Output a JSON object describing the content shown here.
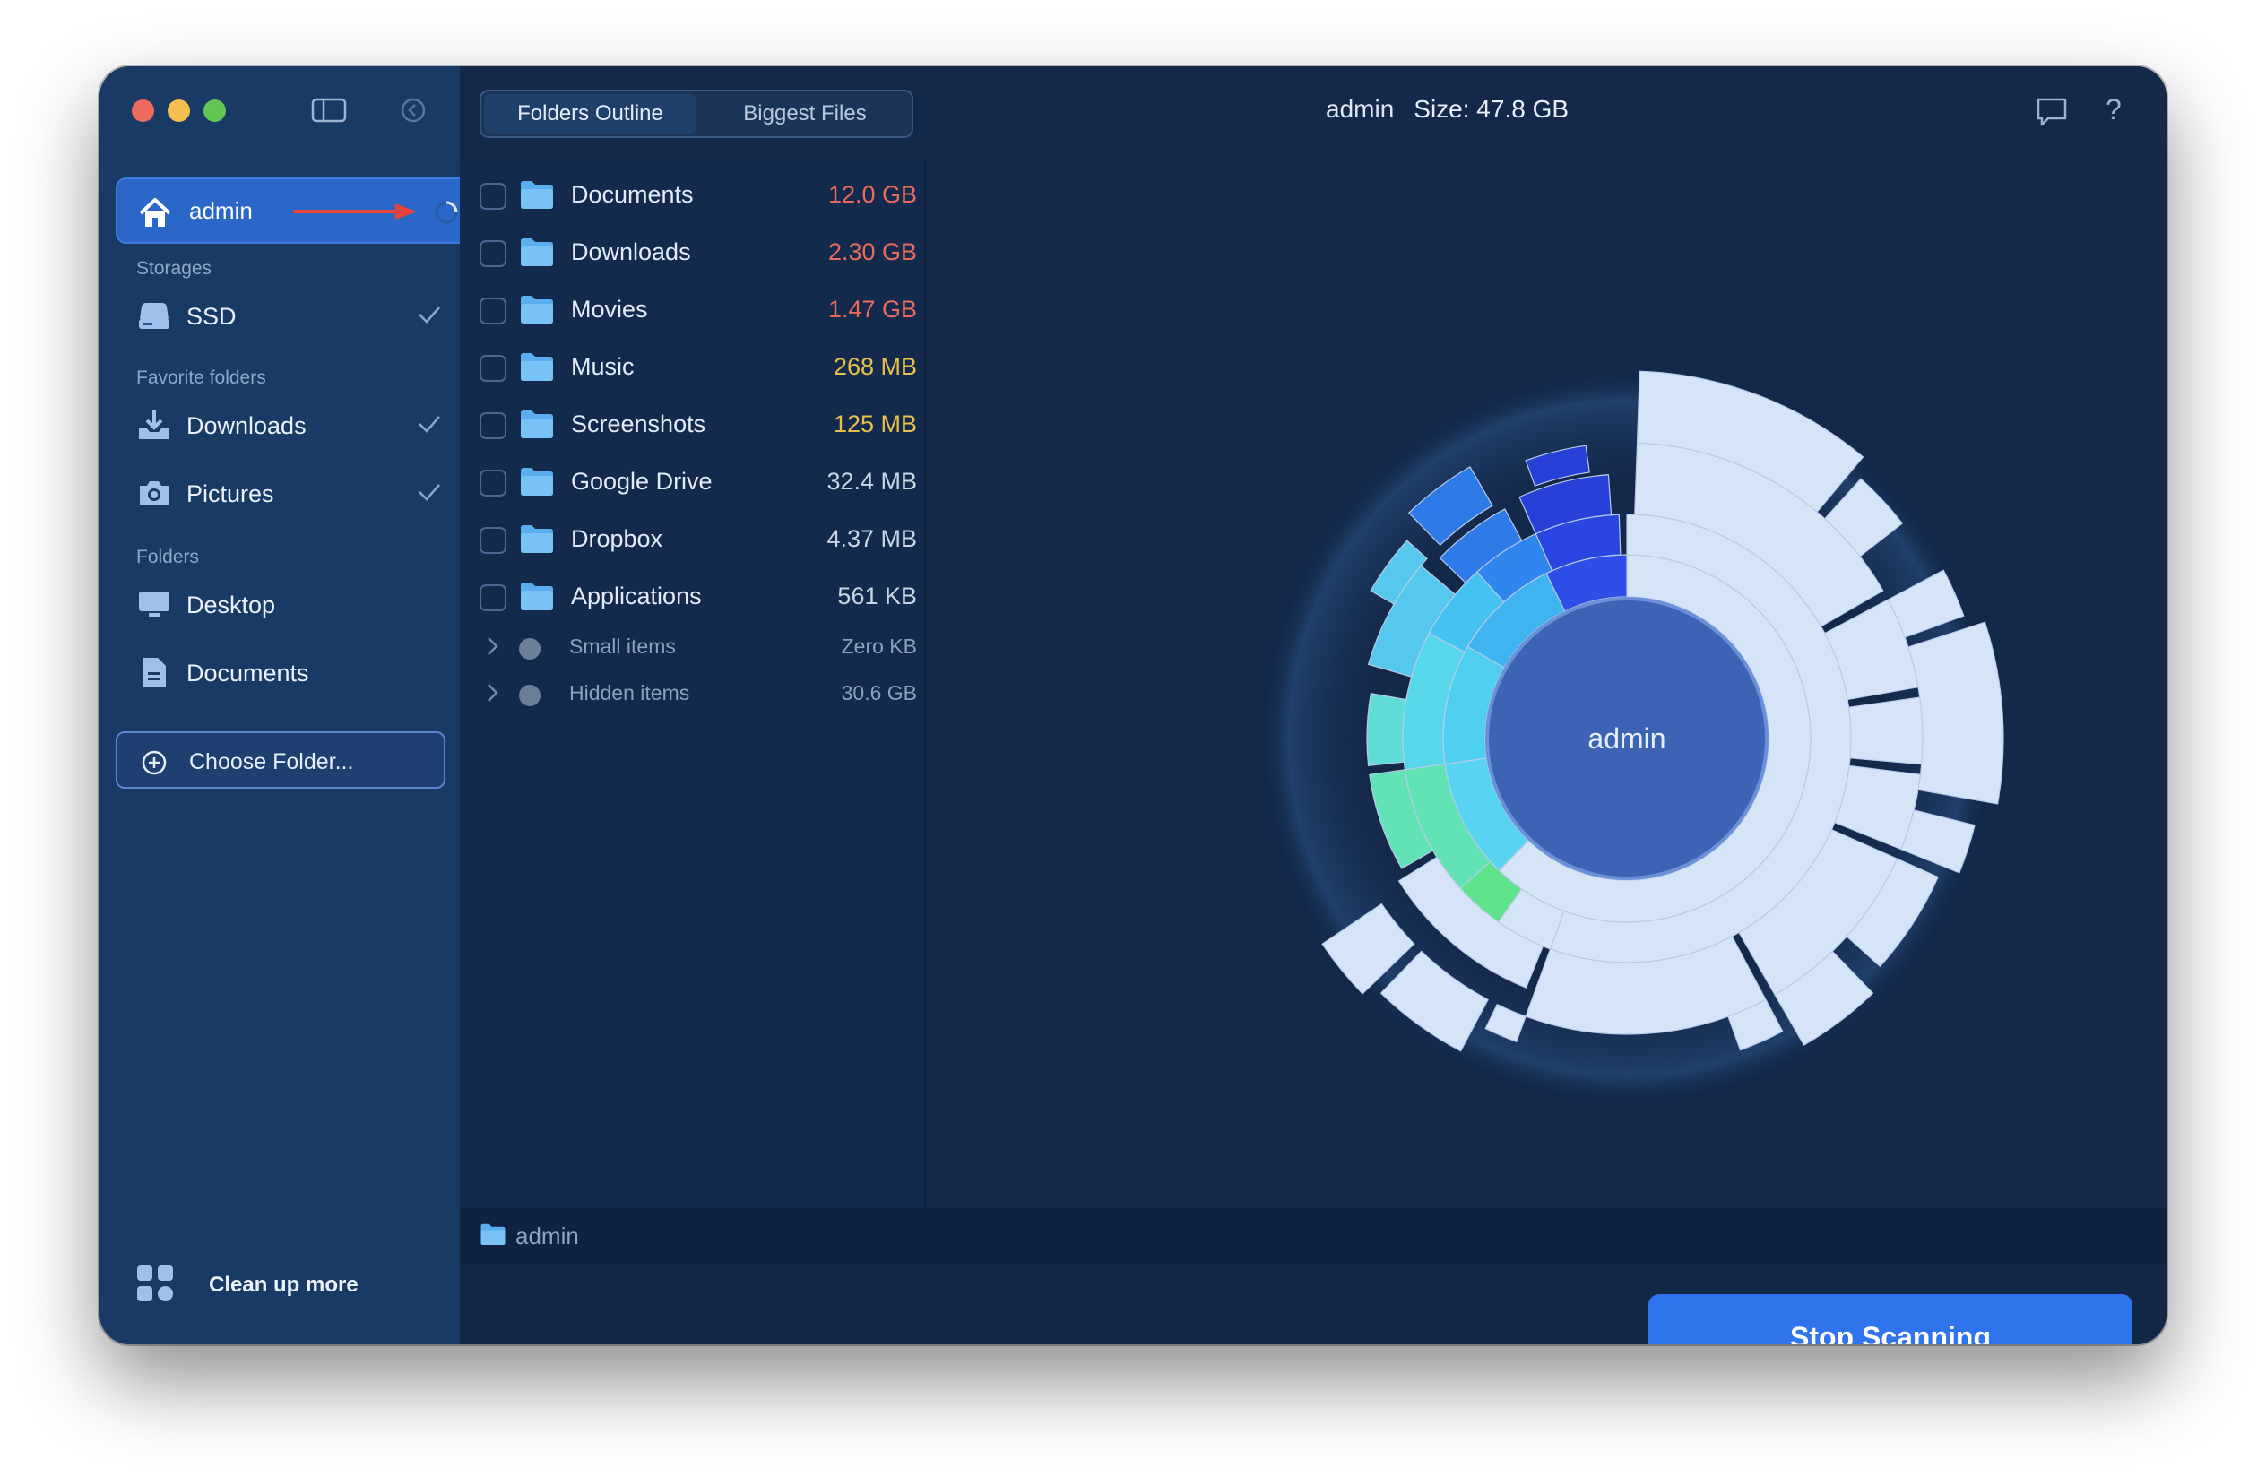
{
  "window": {
    "title_user": "admin",
    "title_size": "Size: 47.8 GB"
  },
  "sidebar": {
    "home": {
      "label": "admin"
    },
    "storages_header": "Storages",
    "storages": [
      {
        "label": "SSD"
      }
    ],
    "favorites_header": "Favorite folders",
    "favorites": [
      {
        "label": "Downloads"
      },
      {
        "label": "Pictures"
      }
    ],
    "folders_header": "Folders",
    "folders": [
      {
        "label": "Desktop"
      },
      {
        "label": "Documents"
      }
    ],
    "choose_folder": "Choose Folder...",
    "cleanup": "Clean up more"
  },
  "toolbar": {
    "tabs": [
      {
        "label": "Folders Outline",
        "selected": true
      },
      {
        "label": "Biggest Files",
        "selected": false
      }
    ]
  },
  "list": {
    "items": [
      {
        "name": "Documents",
        "size": "12.0 GB",
        "color": "#e86a5a"
      },
      {
        "name": "Downloads",
        "size": "2.30 GB",
        "color": "#e86a5a"
      },
      {
        "name": "Movies",
        "size": "1.47 GB",
        "color": "#e86a5a"
      },
      {
        "name": "Music",
        "size": "268 MB",
        "color": "#e6c04a"
      },
      {
        "name": "Screenshots",
        "size": "125 MB",
        "color": "#e6c04a"
      },
      {
        "name": "Google Drive",
        "size": "32.4 MB",
        "color": "#c9d4e4"
      },
      {
        "name": "Dropbox",
        "size": "4.37 MB",
        "color": "#c9d4e4"
      },
      {
        "name": "Applications",
        "size": "561 KB",
        "color": "#c9d4e4"
      }
    ],
    "small_items": {
      "name": "Small items",
      "size": "Zero KB"
    },
    "hidden_items": {
      "name": "Hidden items",
      "size": "30.6 GB"
    }
  },
  "chart": {
    "center_label": "admin"
  },
  "pathbar": {
    "label": "admin"
  },
  "actions": {
    "stop_label": "Stop Scanning"
  },
  "colors": {
    "accent": "#2f74ec",
    "sidebar": "#1a3a66",
    "background": "#14284a"
  }
}
